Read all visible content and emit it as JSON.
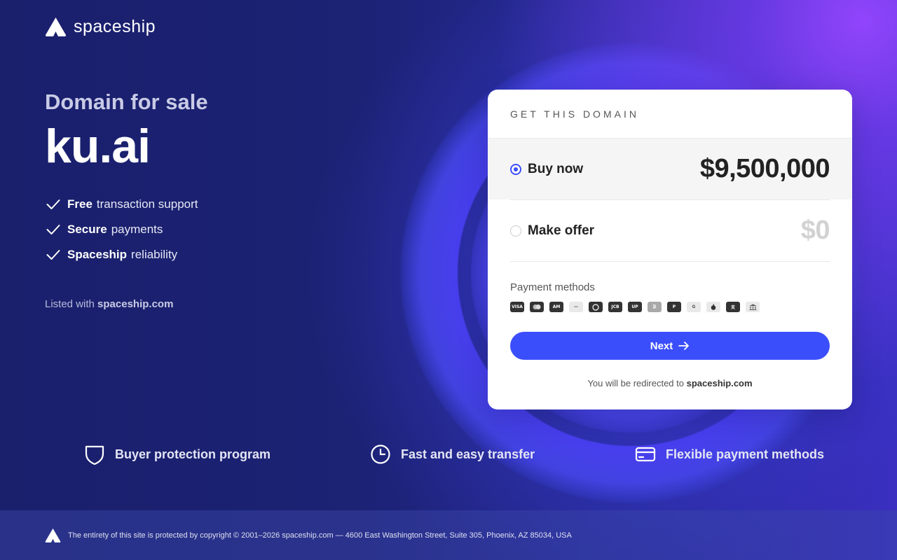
{
  "brand": {
    "name": "spaceship"
  },
  "hero": {
    "eyebrow": "Domain for sale",
    "domain": "ku.ai",
    "features": [
      {
        "bold": "Free",
        "rest": "transaction support"
      },
      {
        "bold": "Secure",
        "rest": "payments"
      },
      {
        "bold": "Spaceship",
        "rest": "reliability"
      }
    ],
    "listed_prefix": "Listed with",
    "listed_site": "spaceship.com"
  },
  "card": {
    "title": "GET THIS DOMAIN",
    "options": [
      {
        "label": "Buy now",
        "price": "$9,500,000",
        "selected": true
      },
      {
        "label": "Make offer",
        "price": "$0",
        "selected": false
      }
    ],
    "payment_title": "Payment methods",
    "payment_icons": [
      "visa-icon",
      "mastercard-icon",
      "amex-icon",
      "discover-icon",
      "diners-icon",
      "jcb-icon",
      "unionpay-icon",
      "bitcoin-icon",
      "paypal-icon",
      "google-pay-icon",
      "apple-pay-icon",
      "alipay-icon",
      "bank-icon"
    ],
    "next_label": "Next",
    "redirect_prefix": "You will be redirected to",
    "redirect_site": "spaceship.com"
  },
  "benefits": [
    {
      "label": "Buyer protection program",
      "icon": "shield-icon"
    },
    {
      "label": "Fast and easy transfer",
      "icon": "clock-icon"
    },
    {
      "label": "Flexible payment methods",
      "icon": "credit-card-icon"
    }
  ],
  "footer": {
    "text": "The entirety of this site is protected by copyright © 2001–2026 spaceship.com — 4600 East Washington Street, Suite 305, Phoenix, AZ 85034, USA"
  },
  "colors": {
    "accent": "#3b4efb",
    "background": "#1b2170",
    "glow": "#7a3cf0"
  }
}
